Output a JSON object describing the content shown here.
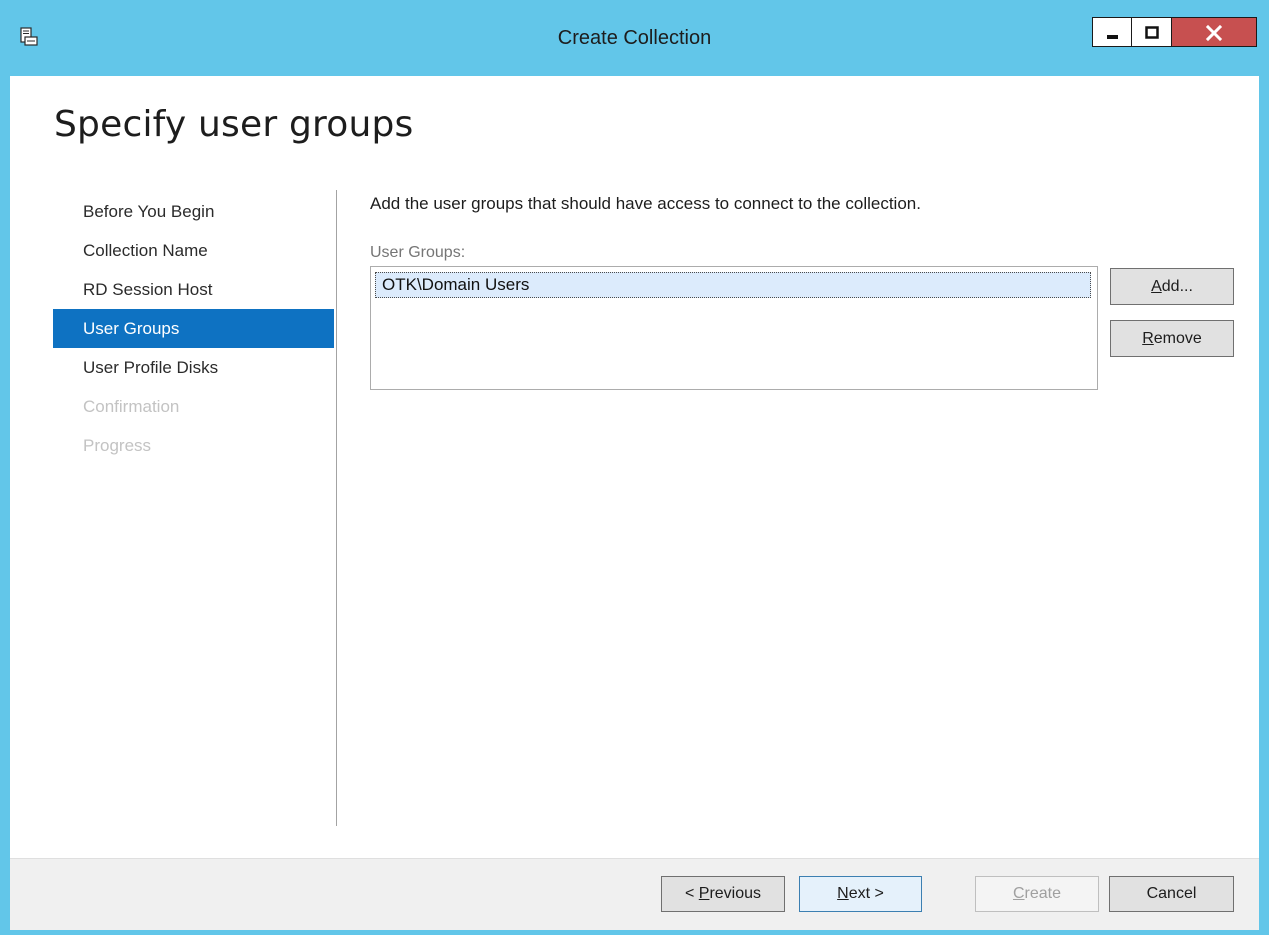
{
  "window": {
    "title": "Create Collection"
  },
  "page": {
    "heading": "Specify user groups"
  },
  "nav": {
    "items": [
      {
        "label": "Before You Begin",
        "state": "normal"
      },
      {
        "label": "Collection Name",
        "state": "normal"
      },
      {
        "label": "RD Session Host",
        "state": "normal"
      },
      {
        "label": "User Groups",
        "state": "active"
      },
      {
        "label": "User Profile Disks",
        "state": "normal"
      },
      {
        "label": "Confirmation",
        "state": "disabled"
      },
      {
        "label": "Progress",
        "state": "disabled"
      }
    ]
  },
  "content": {
    "description": "Add the user groups that should have access to connect to the collection.",
    "list_label": "User Groups:",
    "user_groups": [
      "OTK\\Domain Users"
    ],
    "add_button": {
      "mnemonic": "A",
      "rest": "dd..."
    },
    "remove_button": {
      "mnemonic": "R",
      "rest": "emove"
    }
  },
  "footer": {
    "previous_button": {
      "prefix": "< ",
      "mnemonic": "P",
      "rest": "revious"
    },
    "next_button": {
      "mnemonic": "N",
      "rest": "ext >"
    },
    "create_button": {
      "mnemonic": "C",
      "rest": "reate"
    },
    "cancel_label": "Cancel"
  },
  "colors": {
    "titlebar": "#62c6e9",
    "nav_active": "#0e72c2",
    "close_button": "#c75050",
    "selection": "#dcebfc"
  }
}
